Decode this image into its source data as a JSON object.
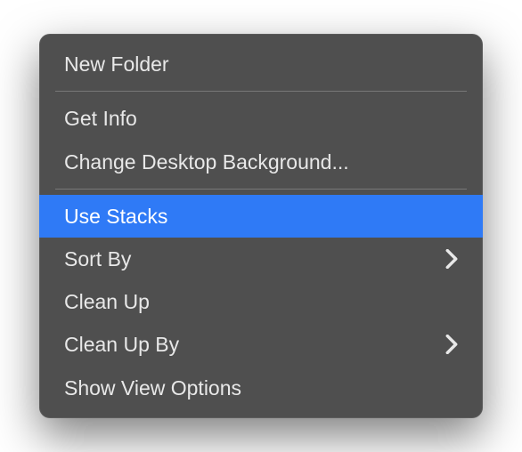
{
  "menu": {
    "sections": [
      {
        "items": [
          {
            "label": "New Folder",
            "submenu": false,
            "highlighted": false
          }
        ]
      },
      {
        "items": [
          {
            "label": "Get Info",
            "submenu": false,
            "highlighted": false
          },
          {
            "label": "Change Desktop Background...",
            "submenu": false,
            "highlighted": false
          }
        ]
      },
      {
        "items": [
          {
            "label": "Use Stacks",
            "submenu": false,
            "highlighted": true
          },
          {
            "label": "Sort By",
            "submenu": true,
            "highlighted": false
          },
          {
            "label": "Clean Up",
            "submenu": false,
            "highlighted": false
          },
          {
            "label": "Clean Up By",
            "submenu": true,
            "highlighted": false
          },
          {
            "label": "Show View Options",
            "submenu": false,
            "highlighted": false
          }
        ]
      }
    ]
  },
  "colors": {
    "menu_bg": "#4f4f4f",
    "highlight": "#2f7af6",
    "text": "#e8e8e8",
    "separator": "#787878"
  }
}
